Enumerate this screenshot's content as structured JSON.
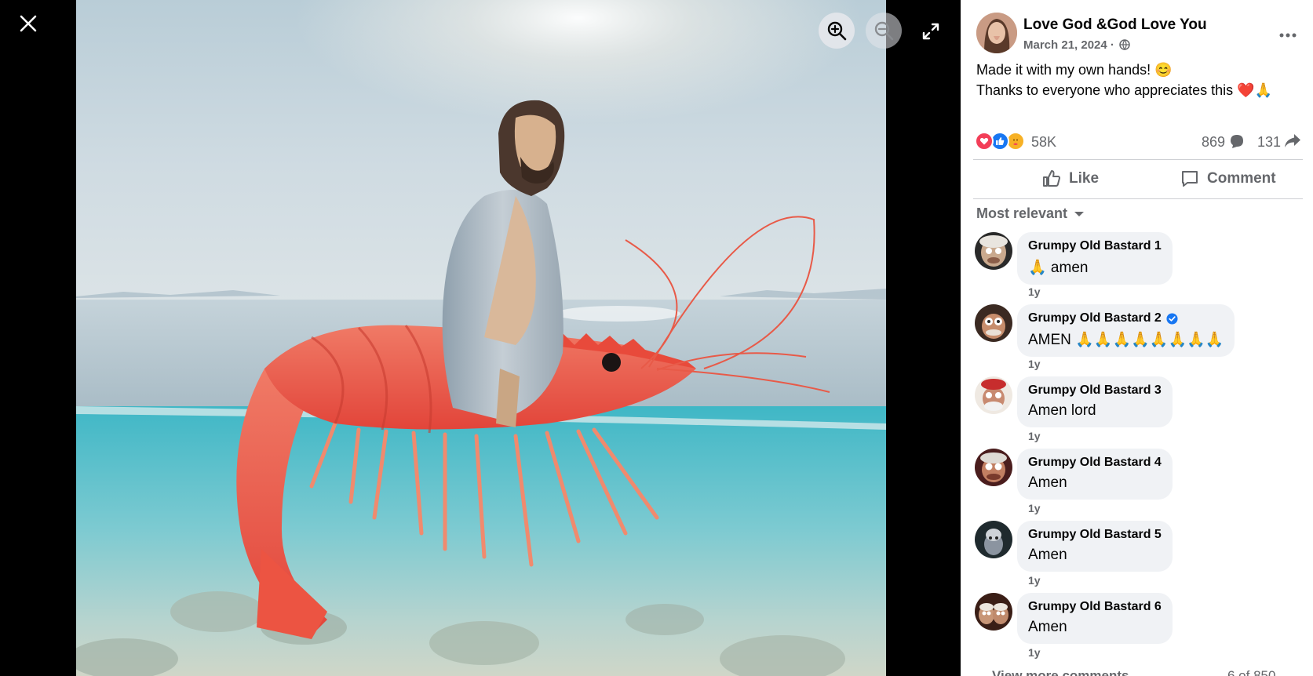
{
  "viewer": {
    "close_icon": "close-icon",
    "zoom_in_icon": "zoom-in-icon",
    "zoom_out_icon": "zoom-out-icon",
    "fullscreen_icon": "fullscreen-icon"
  },
  "post": {
    "page_name": "Love God &God Love You",
    "date": "March 21, 2024",
    "date_separator": "·",
    "audience_icon": "globe-icon",
    "caption_line1": "Made it with my own hands! 😊",
    "caption_line2": "Thanks to everyone who appreciates this ❤️🙏",
    "reactions_count": "58K",
    "comments_count": "869",
    "shares_count": "131",
    "reaction_types": [
      "love",
      "like",
      "care"
    ]
  },
  "actions": {
    "like_label": "Like",
    "comment_label": "Comment"
  },
  "sort": {
    "label": "Most relevant"
  },
  "comments": [
    {
      "author": "Grumpy Old Bastard 1",
      "text": "🙏 amen",
      "time": "1y",
      "verified": false
    },
    {
      "author": "Grumpy Old Bastard 2",
      "text": "AMEN 🙏🙏🙏🙏🙏🙏🙏🙏",
      "time": "1y",
      "verified": true
    },
    {
      "author": "Grumpy Old Bastard 3",
      "text": "Amen lord",
      "time": "1y",
      "verified": false
    },
    {
      "author": "Grumpy Old Bastard 4",
      "text": "Amen",
      "time": "1y",
      "verified": false
    },
    {
      "author": "Grumpy Old Bastard 5",
      "text": "Amen",
      "time": "1y",
      "verified": false
    },
    {
      "author": "Grumpy Old Bastard 6",
      "text": "Amen",
      "time": "1y",
      "verified": false
    }
  ],
  "footer": {
    "view_more": "View more comments",
    "pager": "6 of 850"
  },
  "colors": {
    "secondary_text": "#65676b",
    "bubble": "#f0f2f5",
    "like_blue": "#1877f2",
    "love_red": "#f33e58",
    "verified_blue": "#1877f2"
  }
}
